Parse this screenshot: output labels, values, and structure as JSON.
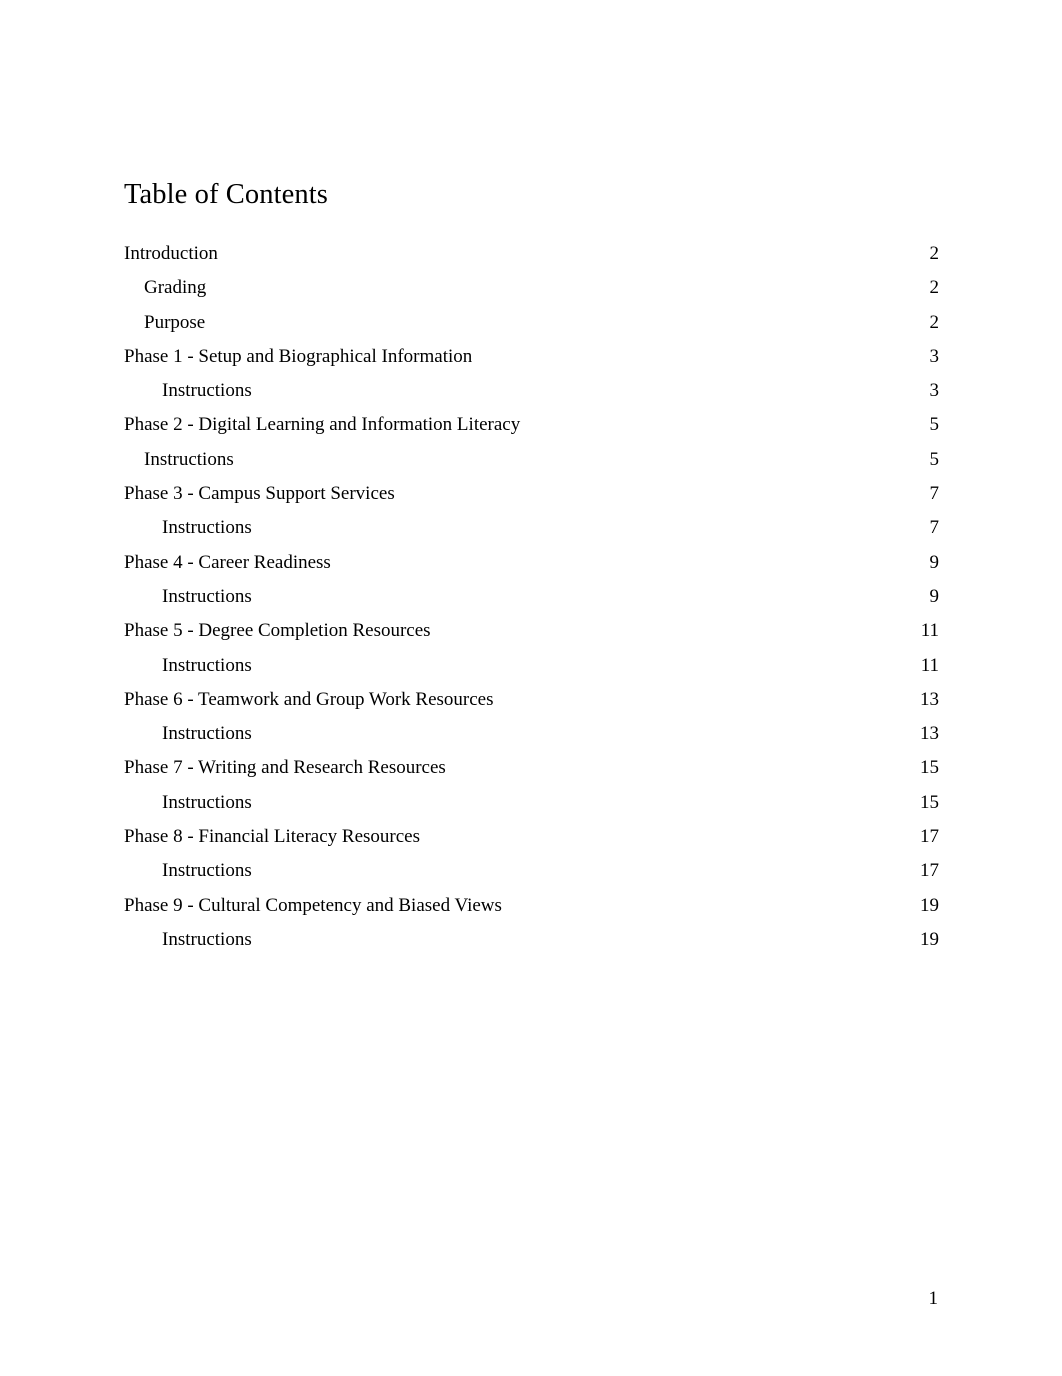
{
  "document": {
    "title": "Table of Contents",
    "footer_page_number": "1",
    "text_color": "#000000",
    "background_color": "#ffffff"
  },
  "toc": {
    "entries": [
      {
        "label": "Introduction",
        "page": "2",
        "level": 0
      },
      {
        "label": "Grading",
        "page": "2",
        "level": 1
      },
      {
        "label": "Purpose",
        "page": "2",
        "level": 1
      },
      {
        "label": "Phase 1 - Setup and Biographical Information",
        "page": "3",
        "level": 0
      },
      {
        "label": "Instructions",
        "page": "3",
        "level": 2
      },
      {
        "label": "Phase 2 - Digital Learning and Information Literacy",
        "page": "5",
        "level": 0
      },
      {
        "label": "Instructions",
        "page": "5",
        "level": 1
      },
      {
        "label": "Phase 3 - Campus Support Services",
        "page": "7",
        "level": 0
      },
      {
        "label": "Instructions",
        "page": "7",
        "level": 2
      },
      {
        "label": "Phase 4 - Career Readiness",
        "page": "9",
        "level": 0
      },
      {
        "label": "Instructions",
        "page": "9",
        "level": 2
      },
      {
        "label": "Phase 5 - Degree Completion Resources",
        "page": "11",
        "level": 0
      },
      {
        "label": "Instructions",
        "page": "11",
        "level": 2
      },
      {
        "label": "Phase 6 - Teamwork and Group Work Resources",
        "page": "13",
        "level": 0
      },
      {
        "label": "Instructions",
        "page": "13",
        "level": 2
      },
      {
        "label": "Phase 7 - Writing and Research Resources",
        "page": "15",
        "level": 0
      },
      {
        "label": "Instructions",
        "page": "15",
        "level": 2
      },
      {
        "label": "Phase 8 - Financial Literacy Resources",
        "page": "17",
        "level": 0
      },
      {
        "label": "Instructions",
        "page": "17",
        "level": 2
      },
      {
        "label": "Phase 9 - Cultural Competency and Biased Views",
        "page": "19",
        "level": 0
      },
      {
        "label": "Instructions",
        "page": "19",
        "level": 2
      }
    ]
  }
}
